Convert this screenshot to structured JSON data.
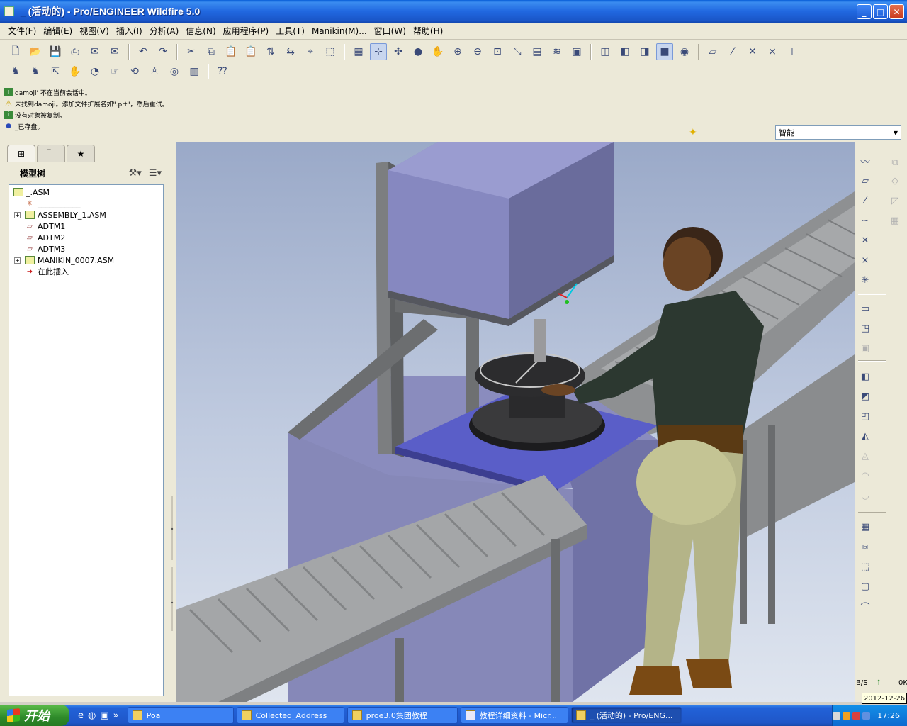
{
  "window": {
    "title": "_ (活动的) - Pro/ENGINEER Wildfire 5.0",
    "buttons": [
      "minimize",
      "maximize",
      "close"
    ]
  },
  "menu": [
    "文件(F)",
    "编辑(E)",
    "视图(V)",
    "插入(I)",
    "分析(A)",
    "信息(N)",
    "应用程序(P)",
    "工具(T)",
    "Manikin(M)...",
    "窗口(W)",
    "帮助(H)"
  ],
  "toolbar_row1": [
    "new-icon",
    "open-icon",
    "save-icon",
    "print-icon",
    "email-icon",
    "email-link-icon",
    "|",
    "undo-icon",
    "redo-icon",
    "|",
    "cut-icon",
    "copy-icon",
    "paste-icon",
    "paste-special-icon",
    "regenerate-icon",
    "regen-manager-icon",
    "find-icon",
    "select-box-icon",
    "|",
    "repaint-icon",
    "spin-center-icon",
    "orient-icon",
    "shade-icon",
    "pan-icon",
    "zoom-in-icon",
    "zoom-out-icon",
    "refit-icon",
    "reorient-icon",
    "view-manager-icon",
    "layers-icon",
    "saved-views-icon",
    "|",
    "wireframe-icon",
    "hidden-line-icon",
    "no-hidden-icon",
    "shading-icon",
    "enhanced-realism-icon",
    "|",
    "datum-planes-icon",
    "datum-axes-icon",
    "datum-points-icon",
    "csys-icon",
    "annotation-icon"
  ],
  "toolbar_row2": [
    "manikin-insert-icon",
    "manikin-posture-icon",
    "manikin-reach-icon",
    "manikin-grasp-icon",
    "manikin-vision-icon",
    "manikin-pointing-icon",
    "manikin-rotate-icon",
    "manikin-analysis-icon",
    "manikin-view-icon",
    "manikin-report-icon",
    "|",
    "context-help-icon"
  ],
  "messages": [
    {
      "type": "info",
      "text": "damoji' 不在当前会话中。"
    },
    {
      "type": "warning",
      "text": "未找到damoji。添加文件扩展名如\".prt\"，然后重试。"
    },
    {
      "type": "info",
      "text": "没有对象被复制。"
    },
    {
      "type": "bullet",
      "text": "_已存盘。"
    }
  ],
  "smart_filter": "智能",
  "model_tree": {
    "title": "模型树",
    "nodes": [
      {
        "label": "_.ASM",
        "icon": "assembly-icon",
        "level": 0,
        "expander": false
      },
      {
        "label": "___________",
        "icon": "csys-icon",
        "level": 1,
        "expander": false
      },
      {
        "label": "ASSEMBLY_1.ASM",
        "icon": "assembly-icon",
        "level": 1,
        "expander": true
      },
      {
        "label": "ADTM1",
        "icon": "datum-plane-icon",
        "level": 1,
        "expander": false
      },
      {
        "label": "ADTM2",
        "icon": "datum-plane-icon",
        "level": 1,
        "expander": false
      },
      {
        "label": "ADTM3",
        "icon": "datum-plane-icon",
        "level": 1,
        "expander": false
      },
      {
        "label": "MANIKIN_0007.ASM",
        "icon": "assembly-icon",
        "level": 1,
        "expander": true
      },
      {
        "label": "在此插入",
        "icon": "insert-here-icon",
        "level": 1,
        "expander": false
      }
    ]
  },
  "status": {
    "rate": "B/S",
    "up": "↑",
    "value": "0K"
  },
  "taskbar": {
    "start": "开始",
    "tasks": [
      {
        "label": "Poa",
        "active": false
      },
      {
        "label": "Collected_Address",
        "active": false
      },
      {
        "label": "proe3.0集团教程",
        "active": false
      },
      {
        "label": "教程详细资料 - Micr...",
        "active": false
      },
      {
        "label": "_ (活动的) - Pro/ENG...",
        "active": true
      }
    ],
    "time": "17:26",
    "date_tip": "2012-12-26"
  },
  "colors": {
    "titlebar": "#2168e0",
    "viewport_top": "#9aa9c8",
    "viewport_bottom": "#dfe5ef",
    "machine_body": "#8a8cc0",
    "table_blue": "#5a5ec8",
    "conveyor": "#9a9c9e"
  }
}
